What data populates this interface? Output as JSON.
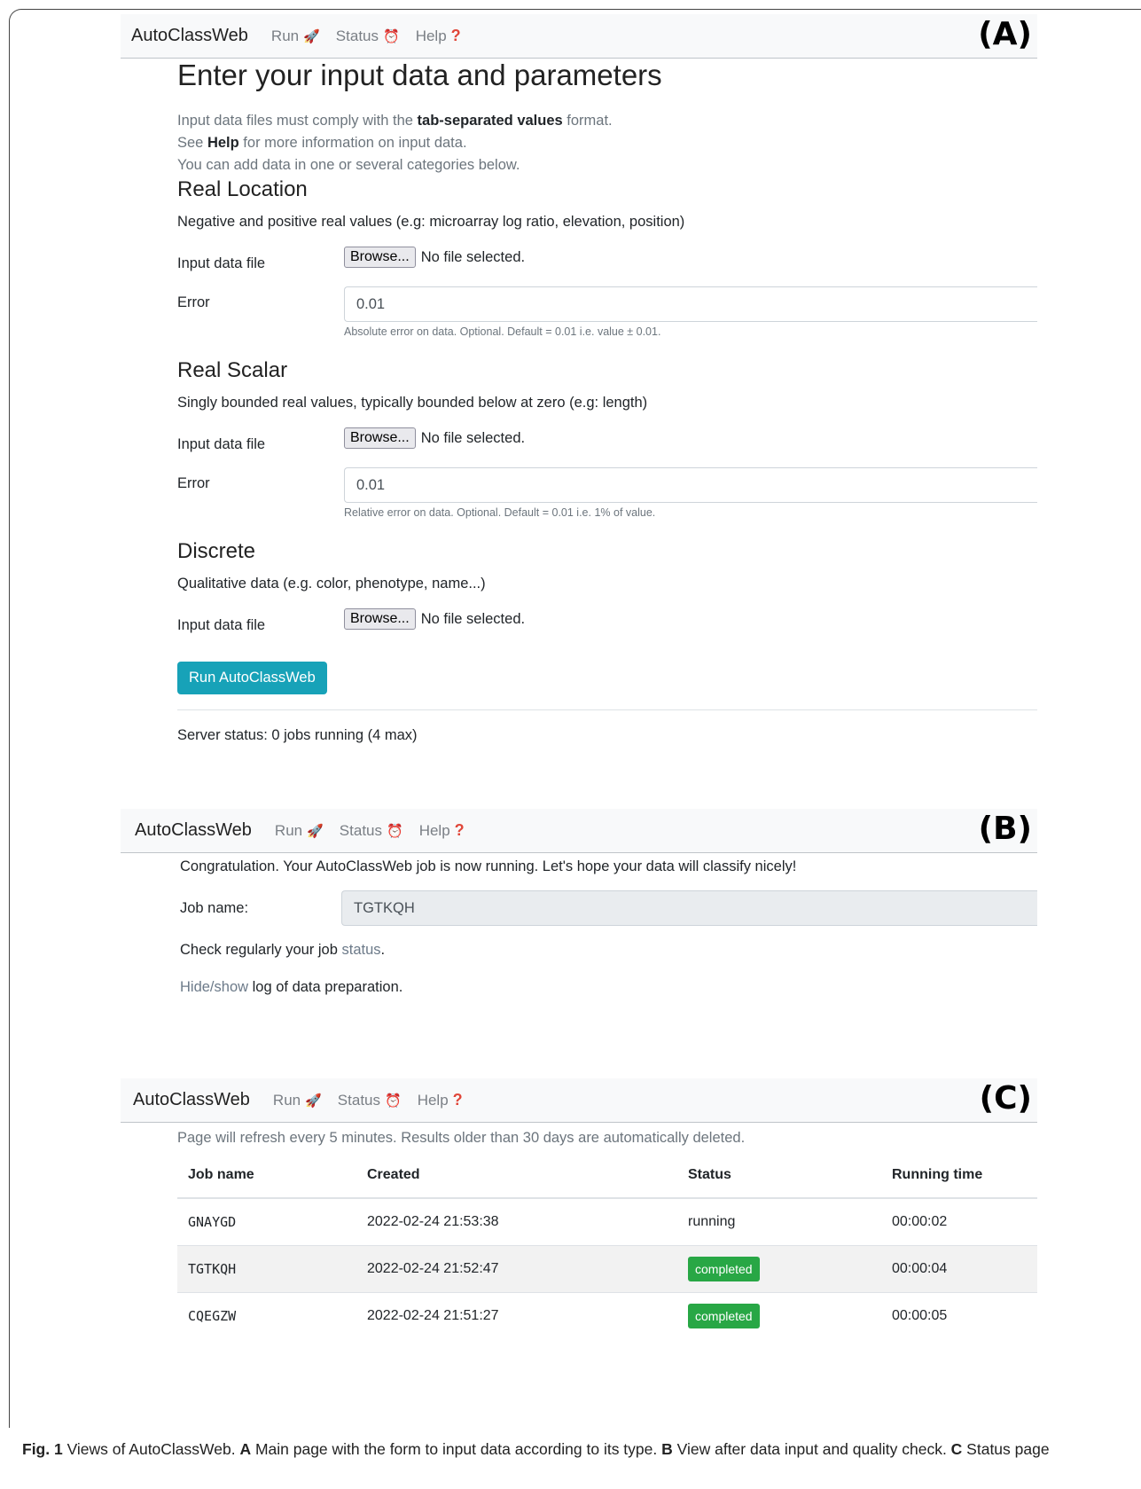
{
  "navbar": {
    "brand": "AutoClassWeb",
    "run": "Run",
    "status": "Status",
    "help": "Help"
  },
  "panels": {
    "a": "(A)",
    "b": "(B)",
    "c": "(C)"
  },
  "form": {
    "title": "Enter your input data and parameters",
    "intro": {
      "line1_pre": "Input data files must comply with the ",
      "line1_bold": "tab-separated values",
      "line1_post": " format.",
      "line2_pre": "See ",
      "line2_bold": "Help",
      "line2_post": " for more information on input data.",
      "line3": "You can add data in one or several categories below."
    },
    "browse_label": "Browse...",
    "no_file": "No file selected.",
    "input_file_label": "Input data file",
    "error_label": "Error",
    "real_location": {
      "heading": "Real Location",
      "description": "Negative and positive real values (e.g: microarray log ratio, elevation, position)",
      "error_value": "0.01",
      "help": "Absolute error on data. Optional. Default = 0.01 i.e. value ± 0.01."
    },
    "real_scalar": {
      "heading": "Real Scalar",
      "description": "Singly bounded real values, typically bounded below at zero (e.g: length)",
      "error_value": "0.01",
      "help": "Relative error on data. Optional. Default = 0.01 i.e. 1% of value."
    },
    "discrete": {
      "heading": "Discrete",
      "description": "Qualitative data (e.g. color, phenotype, name...)"
    },
    "run_button": "Run AutoClassWeb",
    "server_status": "Server status: 0 jobs running (4 max)"
  },
  "running": {
    "message": "Congratulation. Your AutoClassWeb job is now running. Let's hope your data will classify nicely!",
    "job_name_label": "Job name:",
    "job_name_value": "TGTKQH",
    "check_pre": "Check regularly your job ",
    "check_link": "status",
    "check_post": ".",
    "log_link": "Hide/show",
    "log_post": " log of data preparation."
  },
  "status_page": {
    "notice": "Page will refresh every 5 minutes. Results older than 30 days are automatically deleted.",
    "columns": [
      "Job name",
      "Created",
      "Status",
      "Running time"
    ],
    "rows": [
      {
        "job": "GNAYGD",
        "created": "2022-02-24 21:53:38",
        "status": "running",
        "time": "00:00:02"
      },
      {
        "job": "TGTKQH",
        "created": "2022-02-24 21:52:47",
        "status": "completed",
        "time": "00:00:04"
      },
      {
        "job": "CQEGZW",
        "created": "2022-02-24 21:51:27",
        "status": "completed",
        "time": "00:00:05"
      }
    ]
  },
  "caption": {
    "fig": "Fig. 1",
    "intro": "  Views of AutoClassWeb. ",
    "a": "A",
    "a_text": " Main page with the form to input data according to its type. ",
    "b": "B",
    "b_text": " View after data input and quality check. ",
    "c": "C",
    "c_text": " Status page"
  }
}
